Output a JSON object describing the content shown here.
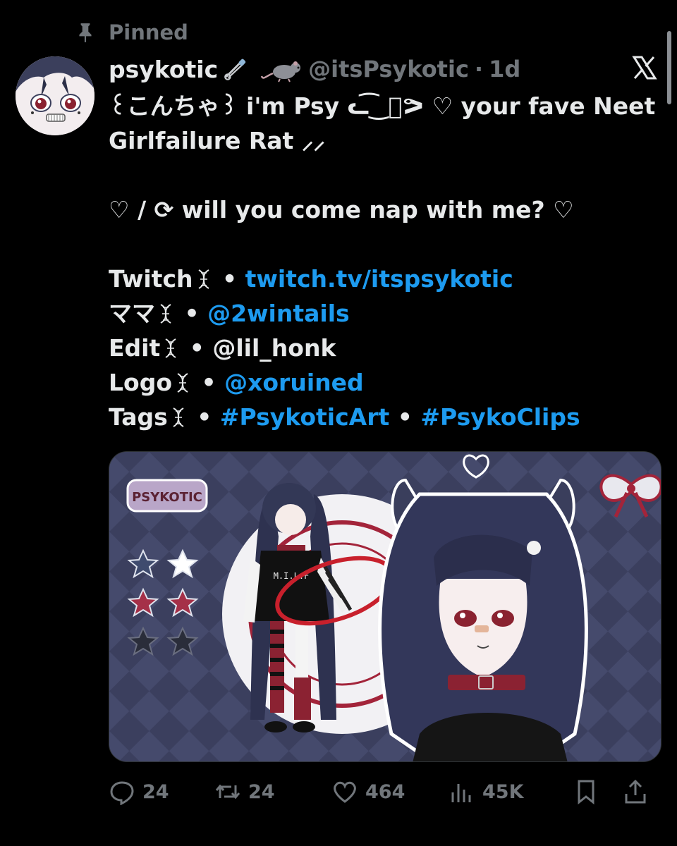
{
  "pinned": {
    "label": "Pinned",
    "icon": "pin-icon"
  },
  "author": {
    "name": "psykotic",
    "name_icons": [
      "safety-pin-icon",
      "rat-icon"
    ],
    "handle": "@itsPsykotic",
    "separator": "·",
    "time": "1d",
    "avatar": "avatar-image"
  },
  "brand_icon": "x-logo-icon",
  "content": {
    "line1": "꒰こんちゃ꒱ i'm Psy ᓚ͡‿ͦᕗ ♡ your fave Neet",
    "line2": "Girlfailure Rat ⸝⸝",
    "line3": "♡ / ⟳ will you come nap with me? ♡",
    "links": [
      {
        "label": "Twitch",
        "sep": "•",
        "value": "twitch.tv/itspsykotic",
        "value2": ""
      },
      {
        "label": "ママ",
        "sep": "•",
        "value": "@2wintails",
        "value2": ""
      },
      {
        "label": "Edit",
        "sep": "•",
        "value": "@lil_honk",
        "value2": ""
      },
      {
        "label": "Logo",
        "sep": "•",
        "value": "@xoruined",
        "value2": ""
      },
      {
        "label": "Tags",
        "sep": "•",
        "value": "#PsykoticArt",
        "value2": "#PsykoClips"
      }
    ]
  },
  "media": {
    "image_text": "M.I.L.F",
    "logo_text": "PSYKOTIC",
    "description": "Character reference artwork"
  },
  "actions": {
    "replies": "24",
    "reposts": "24",
    "likes": "464",
    "views": "45K"
  },
  "colors": {
    "background": "#000000",
    "text": "#e7e9ea",
    "muted": "#71767b",
    "link": "#1d9bf0"
  }
}
